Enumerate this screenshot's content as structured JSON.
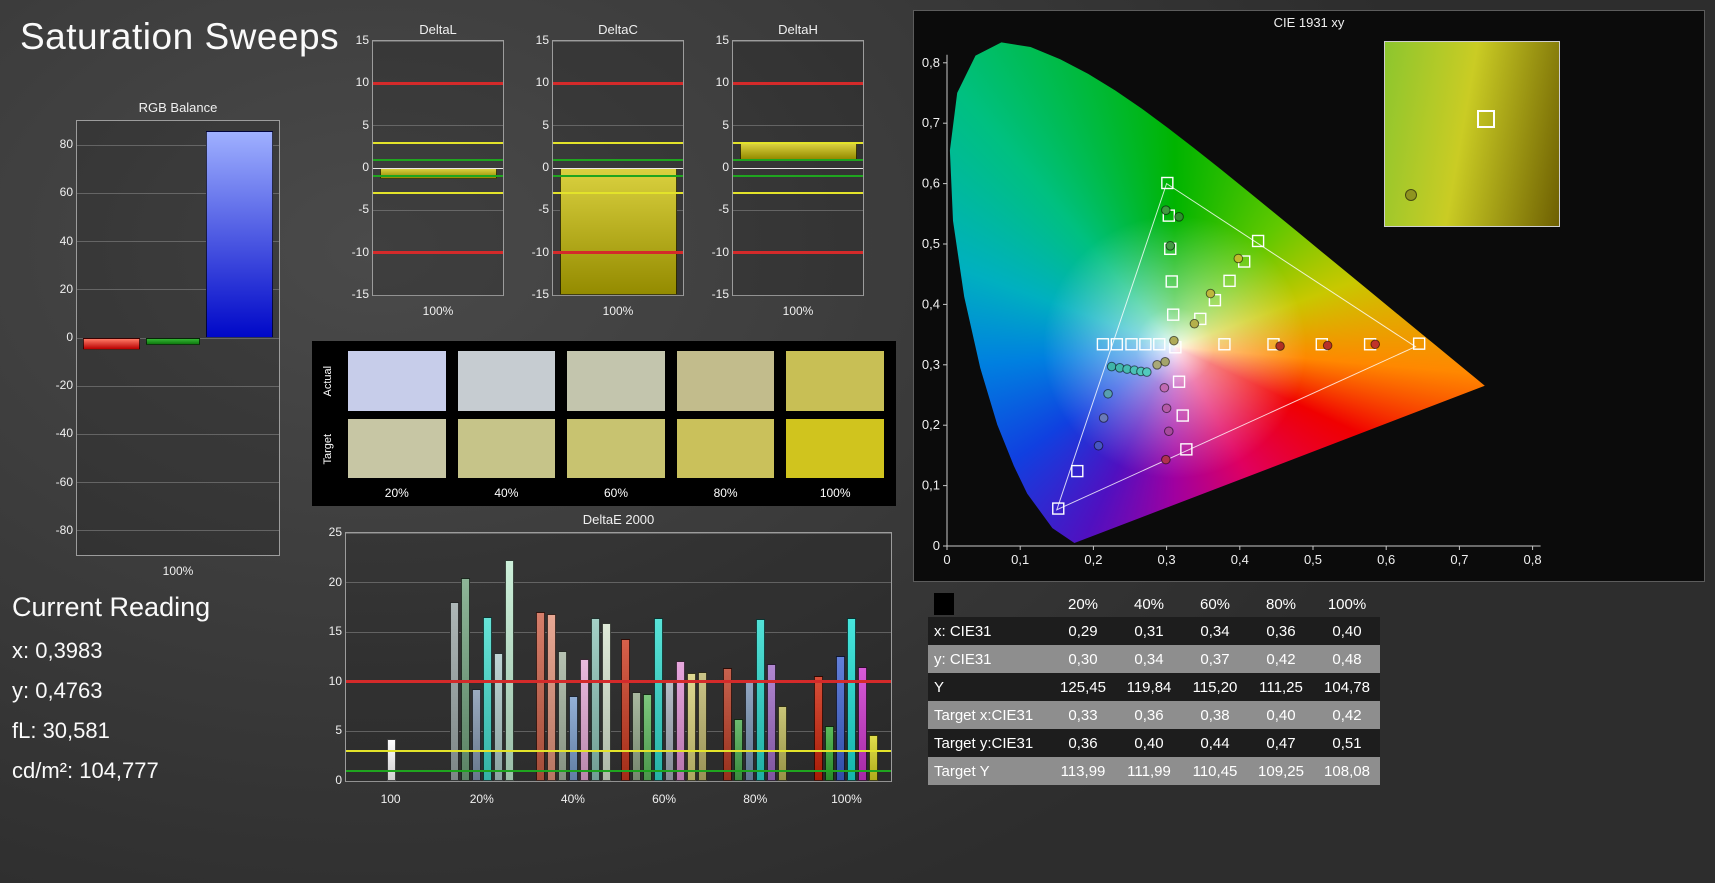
{
  "title": "Saturation Sweeps",
  "current_reading": {
    "title": "Current Reading",
    "lines": [
      "x: 0,3983",
      "y: 0,4763",
      "fL: 30,581",
      "cd/m²: 104,777"
    ]
  },
  "swatches": {
    "col_labels": [
      "20%",
      "40%",
      "60%",
      "80%",
      "100%"
    ],
    "rows": [
      {
        "name": "Actual",
        "colors": [
          "#c7cdea",
          "#c6ccd1",
          "#c3c5ad",
          "#c2bc8c",
          "#c8bf55"
        ]
      },
      {
        "name": "Target",
        "colors": [
          "#c7c6a4",
          "#c6c489",
          "#c8c370",
          "#cac15b",
          "#d0c41e"
        ]
      }
    ]
  },
  "results_table": {
    "columns": [
      "",
      "20%",
      "40%",
      "60%",
      "80%",
      "100%"
    ],
    "rows": [
      {
        "label": "x: CIE31",
        "values": [
          "0,29",
          "0,31",
          "0,34",
          "0,36",
          "0,40"
        ]
      },
      {
        "label": "y: CIE31",
        "values": [
          "0,30",
          "0,34",
          "0,37",
          "0,42",
          "0,48"
        ]
      },
      {
        "label": "Y",
        "values": [
          "125,45",
          "119,84",
          "115,20",
          "111,25",
          "104,78"
        ]
      },
      {
        "label": "Target x:CIE31",
        "values": [
          "0,33",
          "0,36",
          "0,38",
          "0,40",
          "0,42"
        ]
      },
      {
        "label": "Target y:CIE31",
        "values": [
          "0,36",
          "0,40",
          "0,44",
          "0,47",
          "0,51"
        ]
      },
      {
        "label": "Target Y",
        "values": [
          "113,99",
          "111,99",
          "110,45",
          "109,25",
          "108,08"
        ]
      }
    ]
  },
  "chart_data": [
    {
      "id": "rgb_balance",
      "type": "bar",
      "title": "RGB Balance",
      "xlabel": "100%",
      "ylim": [
        -90,
        90
      ],
      "yticks": [
        80,
        60,
        40,
        20,
        0,
        -20,
        -40,
        -60,
        -80
      ],
      "series": [
        {
          "name": "Red",
          "value": -5,
          "color_top": "#ff7a66",
          "color_bottom": "#b80000"
        },
        {
          "name": "Green",
          "value": -3,
          "color_top": "#35b535",
          "color_bottom": "#0f7a0f"
        },
        {
          "name": "Blue",
          "value": 86,
          "color_top": "#9fb0ff",
          "color_bottom": "#0008c8"
        }
      ]
    },
    {
      "id": "deltaL",
      "type": "bar",
      "title": "DeltaL",
      "xlabel": "100%",
      "ylim": [
        -15,
        15
      ],
      "yticks": [
        15,
        10,
        5,
        0,
        -5,
        -10,
        -15
      ],
      "ref_lines": [
        {
          "value": 10,
          "color": "#d42a2a"
        },
        {
          "value": 3,
          "color": "#e3e32a"
        },
        {
          "value": 1,
          "color": "#1fa51f"
        },
        {
          "value": 0,
          "color": "#e8e8e8"
        },
        {
          "value": -1,
          "color": "#1fa51f"
        },
        {
          "value": -3,
          "color": "#e3e32a"
        },
        {
          "value": -10,
          "color": "#d42a2a"
        }
      ],
      "bar": {
        "from": -1.3,
        "to": 0,
        "color": "#b7ae1c"
      }
    },
    {
      "id": "deltaC",
      "type": "bar",
      "title": "DeltaC",
      "xlabel": "100%",
      "ylim": [
        -15,
        15
      ],
      "yticks": [
        15,
        10,
        5,
        0,
        -5,
        -10,
        -15
      ],
      "ref_lines": [
        {
          "value": 10,
          "color": "#d42a2a"
        },
        {
          "value": 3,
          "color": "#e3e32a"
        },
        {
          "value": 1,
          "color": "#1fa51f"
        },
        {
          "value": 0,
          "color": "#e8e8e8"
        },
        {
          "value": -1,
          "color": "#1fa51f"
        },
        {
          "value": -3,
          "color": "#e3e32a"
        },
        {
          "value": -10,
          "color": "#d42a2a"
        }
      ],
      "bar": {
        "from": -15,
        "to": 0,
        "color": "#b7ae1c"
      }
    },
    {
      "id": "deltaH",
      "type": "bar",
      "title": "DeltaH",
      "xlabel": "100%",
      "ylim": [
        -15,
        15
      ],
      "yticks": [
        15,
        10,
        5,
        0,
        -5,
        -10,
        -15
      ],
      "ref_lines": [
        {
          "value": 10,
          "color": "#d42a2a"
        },
        {
          "value": 3,
          "color": "#e3e32a"
        },
        {
          "value": 1,
          "color": "#1fa51f"
        },
        {
          "value": 0,
          "color": "#e8e8e8"
        },
        {
          "value": -1,
          "color": "#1fa51f"
        },
        {
          "value": -3,
          "color": "#e3e32a"
        },
        {
          "value": -10,
          "color": "#d42a2a"
        }
      ],
      "bar": {
        "from": 1,
        "to": 3,
        "color": "#b7ae1c"
      }
    },
    {
      "id": "deltaE2000",
      "type": "bar",
      "title": "DeltaE 2000",
      "ylim": [
        0,
        25
      ],
      "yticks": [
        25,
        20,
        15,
        10,
        5,
        0
      ],
      "ref_lines": [
        {
          "value": 10,
          "color": "#d42a2a"
        },
        {
          "value": 3,
          "color": "#e3e32a"
        },
        {
          "value": 1,
          "color": "#1fa51f"
        }
      ],
      "groups": [
        {
          "label": "100",
          "bars": [
            {
              "value": 4.2,
              "color": "#eeeeee"
            }
          ]
        },
        {
          "label": "20%",
          "bars": [
            {
              "value": 18.0,
              "color": "#9aa4a4"
            },
            {
              "value": 20.5,
              "color": "#79a183"
            },
            {
              "value": 9.3,
              "color": "#8696ab"
            },
            {
              "value": 16.5,
              "color": "#52cfc3"
            },
            {
              "value": 12.9,
              "color": "#a9c0bf"
            },
            {
              "value": 22.3,
              "color": "#b9dcc6"
            }
          ]
        },
        {
          "label": "40%",
          "bars": [
            {
              "value": 17.0,
              "color": "#c26a56"
            },
            {
              "value": 16.8,
              "color": "#d49480"
            },
            {
              "value": 13.1,
              "color": "#a2ae9e"
            },
            {
              "value": 8.6,
              "color": "#7f9cc2"
            },
            {
              "value": 12.3,
              "color": "#d6a6ca"
            },
            {
              "value": 16.4,
              "color": "#8fbcb2"
            },
            {
              "value": 15.9,
              "color": "#ccd6c5"
            }
          ]
        },
        {
          "label": "60%",
          "bars": [
            {
              "value": 14.3,
              "color": "#c24c36"
            },
            {
              "value": 9.0,
              "color": "#94a58c"
            },
            {
              "value": 8.8,
              "color": "#69b369"
            },
            {
              "value": 16.4,
              "color": "#44cfc4"
            },
            {
              "value": 10.0,
              "color": "#a2a9b3"
            },
            {
              "value": 12.1,
              "color": "#d393c9"
            },
            {
              "value": 10.9,
              "color": "#cbc57e"
            },
            {
              "value": 11.0,
              "color": "#b7b074"
            }
          ]
        },
        {
          "label": "80%",
          "bars": [
            {
              "value": 11.4,
              "color": "#b44e3a"
            },
            {
              "value": 6.3,
              "color": "#58a85c"
            },
            {
              "value": 10.0,
              "color": "#7d92ad"
            },
            {
              "value": 16.3,
              "color": "#3ecdc3"
            },
            {
              "value": 11.8,
              "color": "#9d73bd"
            },
            {
              "value": 7.6,
              "color": "#b5b164"
            }
          ]
        },
        {
          "label": "100%",
          "bars": [
            {
              "value": 10.6,
              "color": "#c43a24"
            },
            {
              "value": 5.5,
              "color": "#47a847"
            },
            {
              "value": 12.6,
              "color": "#4f6cc6"
            },
            {
              "value": 16.4,
              "color": "#33d2c9"
            },
            {
              "value": 11.5,
              "color": "#c447c4"
            },
            {
              "value": 4.6,
              "color": "#cdca38"
            }
          ]
        }
      ]
    },
    {
      "id": "cie",
      "type": "scatter",
      "title": "CIE 1931 xy",
      "xlim": [
        0,
        0.8
      ],
      "ylim": [
        0,
        0.8
      ],
      "xticks": [
        "0",
        "0,1",
        "0,2",
        "0,3",
        "0,4",
        "0,5",
        "0,6",
        "0,7",
        "0,8"
      ],
      "yticks": [
        "0",
        "0,1",
        "0,2",
        "0,3",
        "0,4",
        "0,5",
        "0,6",
        "0,7",
        "0,8"
      ],
      "gamut_triangle": [
        [
          0.64,
          0.33
        ],
        [
          0.3,
          0.6
        ],
        [
          0.15,
          0.06
        ]
      ],
      "target_squares": [
        [
          0.213,
          0.334
        ],
        [
          0.232,
          0.334
        ],
        [
          0.252,
          0.334
        ],
        [
          0.271,
          0.334
        ],
        [
          0.29,
          0.334
        ],
        [
          0.312,
          0.329
        ],
        [
          0.379,
          0.334
        ],
        [
          0.446,
          0.334
        ],
        [
          0.512,
          0.334
        ],
        [
          0.578,
          0.334
        ],
        [
          0.645,
          0.335
        ],
        [
          0.301,
          0.601
        ],
        [
          0.303,
          0.547
        ],
        [
          0.305,
          0.492
        ],
        [
          0.307,
          0.438
        ],
        [
          0.309,
          0.383
        ],
        [
          0.346,
          0.376
        ],
        [
          0.366,
          0.407
        ],
        [
          0.386,
          0.439
        ],
        [
          0.406,
          0.471
        ],
        [
          0.425,
          0.505
        ],
        [
          0.317,
          0.272
        ],
        [
          0.322,
          0.216
        ],
        [
          0.327,
          0.16
        ],
        [
          0.178,
          0.124
        ],
        [
          0.152,
          0.062
        ]
      ],
      "measurement_dots": [
        {
          "x": 0.225,
          "y": 0.297,
          "color": "#3fb3a9"
        },
        {
          "x": 0.236,
          "y": 0.295,
          "color": "#42b7ad"
        },
        {
          "x": 0.246,
          "y": 0.293,
          "color": "#46bcb1"
        },
        {
          "x": 0.256,
          "y": 0.291,
          "color": "#4ac1b6"
        },
        {
          "x": 0.265,
          "y": 0.289,
          "color": "#4ec6ba"
        },
        {
          "x": 0.273,
          "y": 0.288,
          "color": "#52cabe"
        },
        {
          "x": 0.287,
          "y": 0.3,
          "color": "#a9a978"
        },
        {
          "x": 0.298,
          "y": 0.305,
          "color": "#a4a46b"
        },
        {
          "x": 0.31,
          "y": 0.34,
          "color": "#aeab57"
        },
        {
          "x": 0.338,
          "y": 0.368,
          "color": "#b5b04b"
        },
        {
          "x": 0.36,
          "y": 0.418,
          "color": "#bdb63c"
        },
        {
          "x": 0.398,
          "y": 0.476,
          "color": "#c1bb2d"
        },
        {
          "x": 0.299,
          "y": 0.556,
          "color": "#3f9a3f"
        },
        {
          "x": 0.317,
          "y": 0.545,
          "color": "#2f8f2f"
        },
        {
          "x": 0.305,
          "y": 0.497,
          "color": "#459a45"
        },
        {
          "x": 0.455,
          "y": 0.331,
          "color": "#b03024"
        },
        {
          "x": 0.52,
          "y": 0.332,
          "color": "#b83228"
        },
        {
          "x": 0.585,
          "y": 0.334,
          "color": "#c0342a"
        },
        {
          "x": 0.297,
          "y": 0.262,
          "color": "#c06ab2"
        },
        {
          "x": 0.3,
          "y": 0.228,
          "color": "#b55aa8"
        },
        {
          "x": 0.303,
          "y": 0.19,
          "color": "#a84a9e"
        },
        {
          "x": 0.299,
          "y": 0.143,
          "color": "#b03050"
        },
        {
          "x": 0.207,
          "y": 0.166,
          "color": "#4656c2"
        },
        {
          "x": 0.214,
          "y": 0.212,
          "color": "#6a7ab8"
        },
        {
          "x": 0.22,
          "y": 0.252,
          "color": "#58a0b0"
        }
      ],
      "inset": {
        "square": [
          0.58,
          0.42
        ],
        "dot": [
          0.15,
          0.83
        ],
        "dot_color": "#8f9420"
      }
    }
  ]
}
